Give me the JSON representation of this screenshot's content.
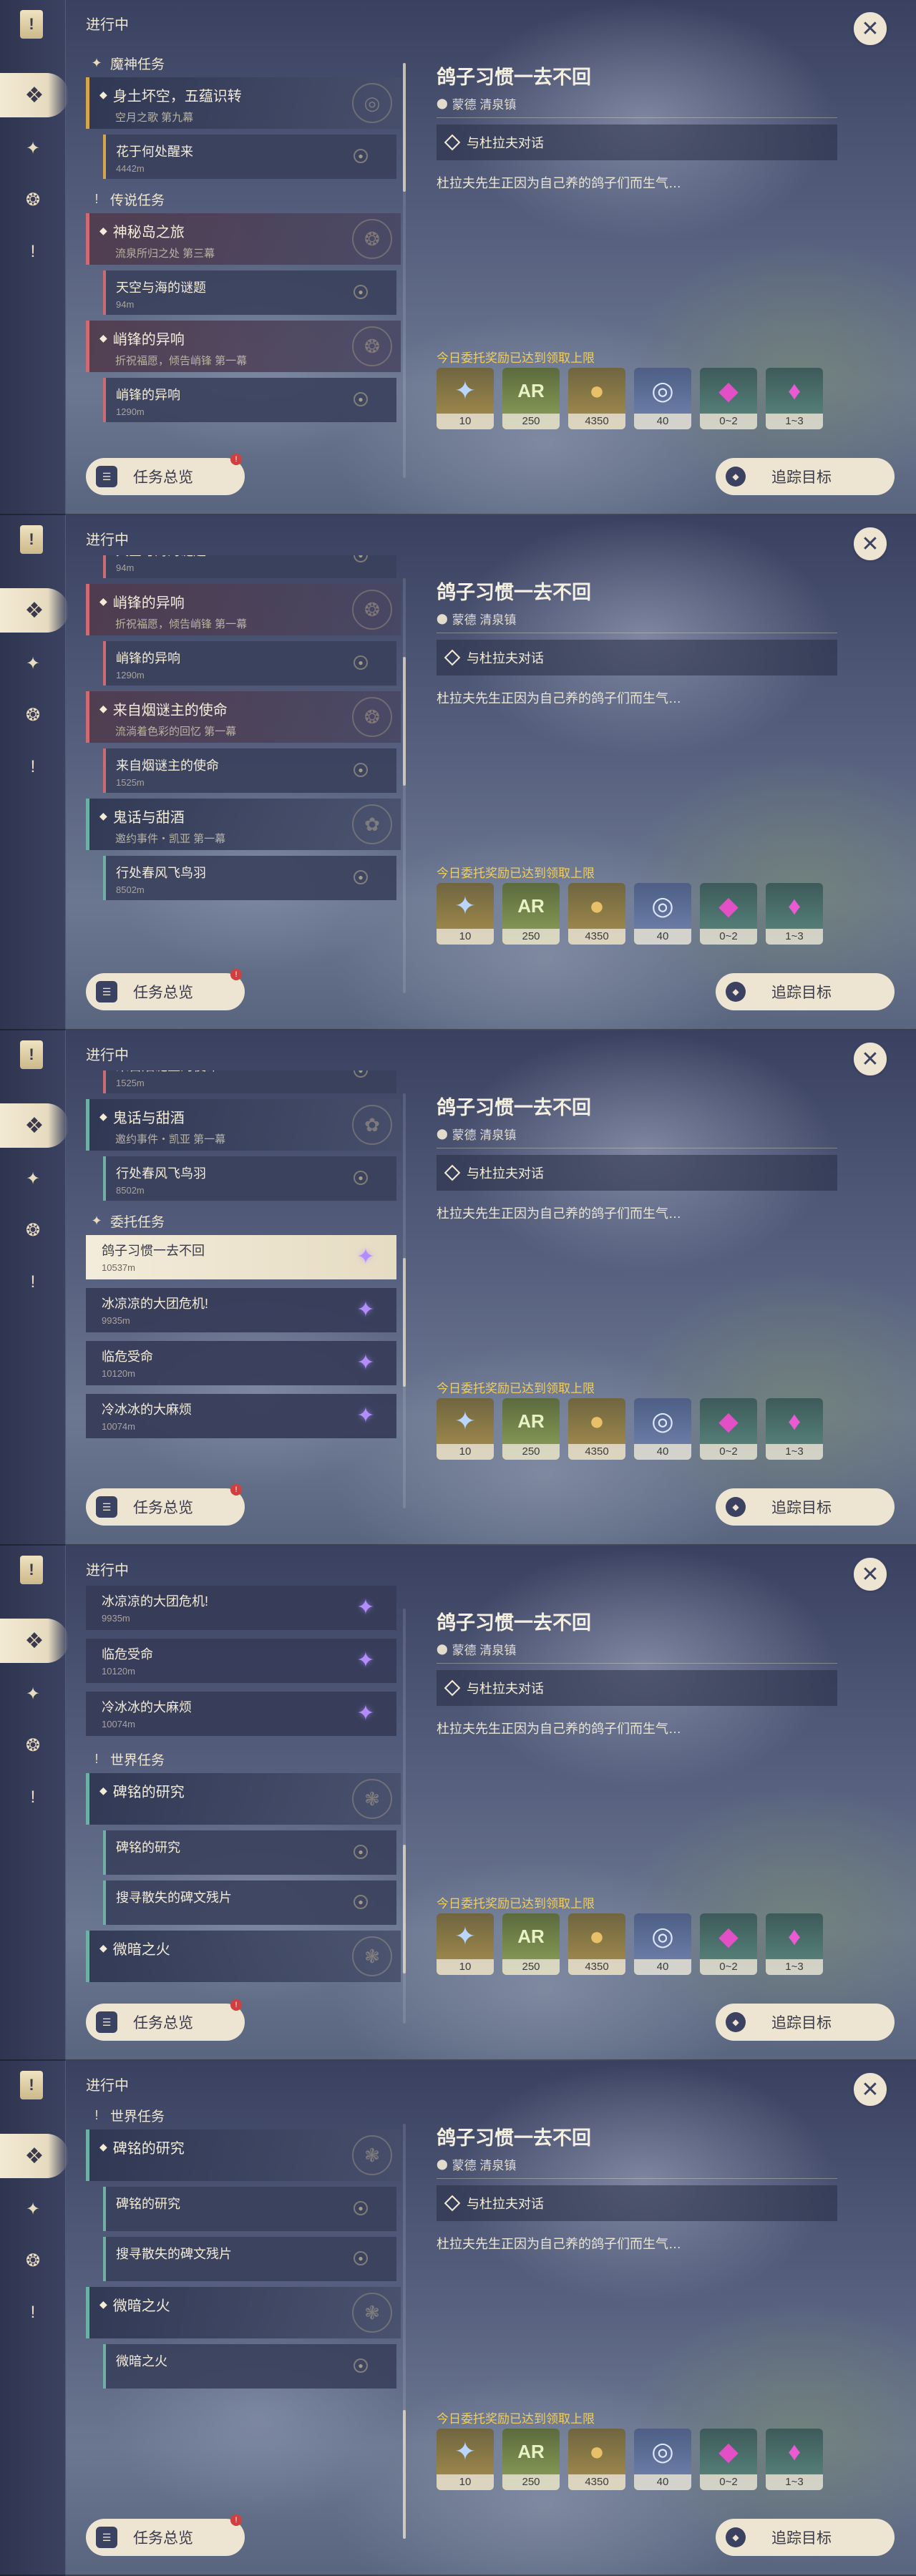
{
  "header": {
    "in_progress": "进行中"
  },
  "buttons": {
    "overview": "任务总览",
    "track": "追踪目标",
    "overview_badge": "!"
  },
  "detail": {
    "title": "鸽子习惯一去不回",
    "location": "蒙德 清泉镇",
    "objective": "与杜拉夫对话",
    "description": "杜拉夫先生正因为自己养的鸽子们而生气…",
    "reward_note": "今日委托奖励已达到领取上限",
    "rewards": [
      {
        "icon": "exp-star-icon",
        "qty": "10"
      },
      {
        "icon": "adventure-exp-icon",
        "qty": "250"
      },
      {
        "icon": "mora-coin-icon",
        "qty": "4350"
      },
      {
        "icon": "reputation-icon",
        "qty": "40"
      },
      {
        "icon": "crystal-gem-icon",
        "qty": "0~2"
      },
      {
        "icon": "crystal-chunk-icon",
        "qty": "1~3"
      }
    ]
  },
  "quests": {
    "cat_archon": "魔神任务",
    "archon_1_title": "身土坏空，五蕴识转",
    "archon_1_sub": "空月之歌 第九幕",
    "archon_1_step": "花于何处醒来",
    "archon_1_step_dist": "4442m",
    "cat_legend": "传说任务",
    "legend_1_title": "神秘岛之旅",
    "legend_1_sub": "流泉所归之处 第三幕",
    "legend_1_step": "天空与海的谜题",
    "legend_1_step_dist": "94m",
    "legend_2_title": "峭锋的异响",
    "legend_2_sub": "折祝福愿，倾告峭锋 第一幕",
    "legend_2_step": "峭锋的异响",
    "legend_2_step_dist": "1290m",
    "legend_3_title": "来自烟谜主的使命",
    "legend_3_sub": "流淌着色彩的回忆 第一幕",
    "legend_3_step": "来自烟谜主的使命",
    "legend_3_step_dist": "1525m",
    "event_title": "鬼话与甜酒",
    "event_sub": "邀约事件・凯亚 第一幕",
    "event_step": "行处春风飞鸟羽",
    "event_step_dist": "8502m",
    "cat_commission": "委托任务",
    "comm_1": "鸽子习惯一去不回",
    "comm_1_dist": "10537m",
    "comm_2": "冰凉凉的大团危机!",
    "comm_2_dist": "9935m",
    "comm_3": "临危受命",
    "comm_3_dist": "10120m",
    "comm_4": "冷冰冰的大麻烦",
    "comm_4_dist": "10074m",
    "cat_world": "世界任务",
    "world_1_title": "碑铭的研究",
    "world_1_step_1": "碑铭的研究",
    "world_1_step_2": "搜寻散失的碑文残片",
    "world_2_title": "微暗之火",
    "world_2_step": "微暗之火"
  }
}
